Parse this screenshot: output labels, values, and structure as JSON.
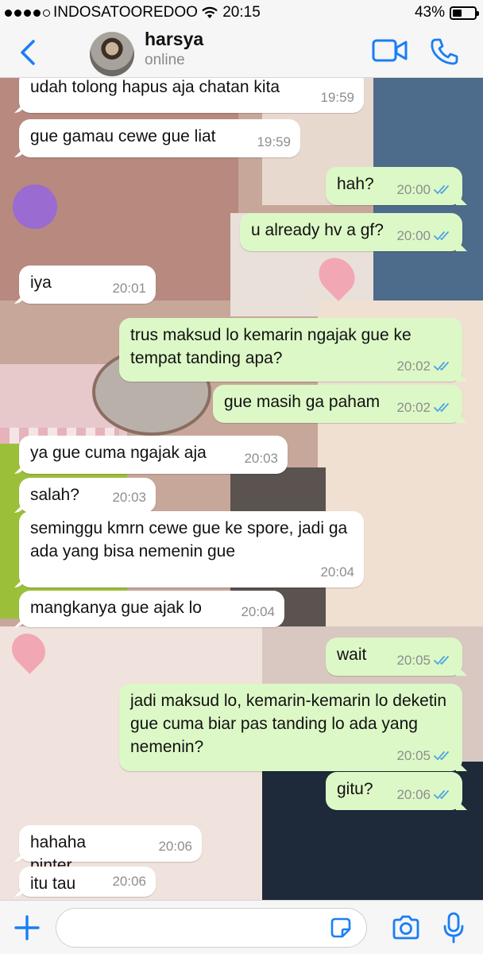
{
  "status_bar": {
    "carrier": "INDOSATOOREDOO",
    "time": "20:15",
    "battery": "43%",
    "battery_level": 0.43,
    "signal_bars": 4
  },
  "header": {
    "contact_name": "harsya",
    "contact_status": "online",
    "accent_color": "#1a7ef5"
  },
  "messages": [
    {
      "dir": "in",
      "text": "udah tolong hapus aja chatan kita",
      "time": "19:59"
    },
    {
      "dir": "in",
      "text": "gue gamau cewe gue liat",
      "time": "19:59"
    },
    {
      "dir": "out",
      "text": "hah?",
      "time": "20:00"
    },
    {
      "dir": "out",
      "text": "u already hv a gf?",
      "time": "20:00"
    },
    {
      "dir": "in",
      "text": "iya",
      "time": "20:01"
    },
    {
      "dir": "out",
      "text": "trus maksud lo kemarin ngajak gue ke tempat tanding apa?",
      "time": "20:02"
    },
    {
      "dir": "out",
      "text": "gue masih ga paham",
      "time": "20:02"
    },
    {
      "dir": "in",
      "text": "ya gue cuma ngajak aja",
      "time": "20:03"
    },
    {
      "dir": "in",
      "text": "salah?",
      "time": "20:03"
    },
    {
      "dir": "in",
      "text": "seminggu kmrn cewe gue ke spore, jadi ga ada yang bisa nemenin gue",
      "time": "20:04"
    },
    {
      "dir": "in",
      "text": "mangkanya gue ajak lo",
      "time": "20:04"
    },
    {
      "dir": "out",
      "text": "wait",
      "time": "20:05"
    },
    {
      "dir": "out",
      "text": "jadi maksud lo, kemarin-kemarin lo deketin gue cuma biar pas tanding lo ada yang nemenin?",
      "time": "20:05"
    },
    {
      "dir": "out",
      "text": "gitu?",
      "time": "20:06"
    },
    {
      "dir": "in",
      "text": "hahaha pinter",
      "time": "20:06"
    },
    {
      "dir": "in",
      "text": "itu tau",
      "time": "20:06"
    }
  ],
  "input": {
    "placeholder": "",
    "value": ""
  },
  "icons": [
    "back-chevron-icon",
    "video-call-icon",
    "phone-call-icon",
    "plus-icon",
    "sticker-icon",
    "camera-icon",
    "microphone-icon",
    "double-check-icon",
    "wifi-icon",
    "battery-icon"
  ],
  "colors": {
    "outgoing_bubble": "#dcf8c6",
    "incoming_bubble": "#ffffff",
    "read_ticks": "#4fa3e0"
  }
}
